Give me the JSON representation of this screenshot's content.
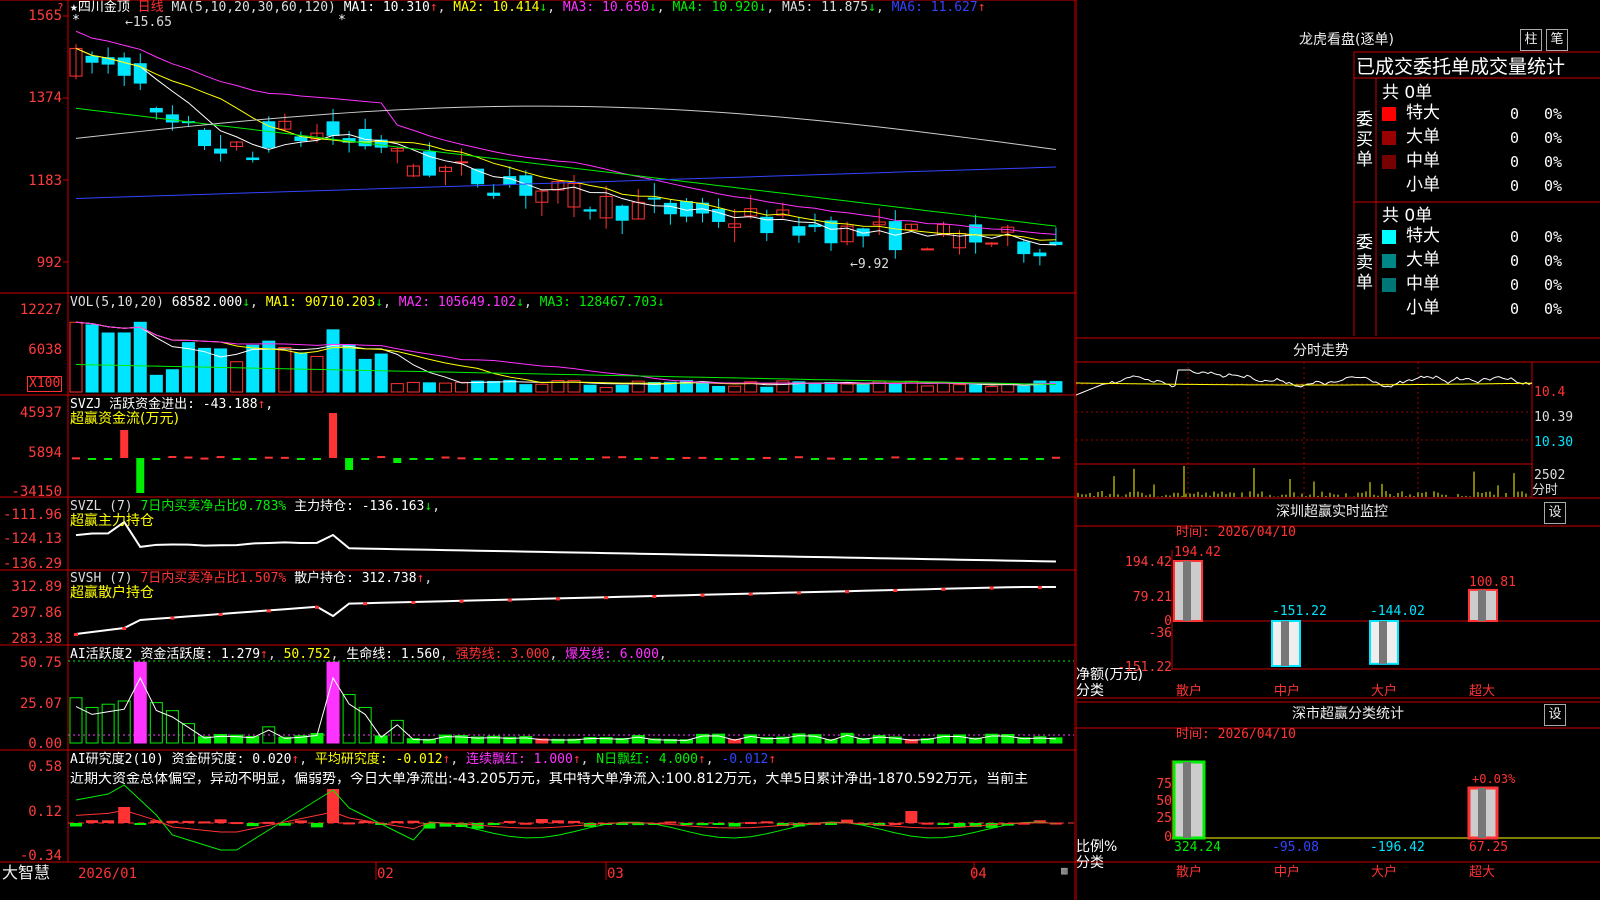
{
  "app_name": "大智慧",
  "colors": {
    "up": "#ff3333",
    "down": "#00e5ff",
    "green": "#00ee00",
    "magenta": "#ff33ff",
    "grid": "#8b0000",
    "border": "#cc0000"
  },
  "kline": {
    "stock_name": "四川金顶",
    "period": "日线",
    "ma_header": "MA(5,10,20,30,60,120)",
    "ma_items": [
      {
        "label": "MA1: 10.310",
        "arrow": "↑",
        "color": "#ffffff"
      },
      {
        "label": "MA2: 10.414",
        "arrow": "↓",
        "color": "#ffff00"
      },
      {
        "label": "MA3: 10.650",
        "arrow": "↓",
        "color": "#ff33ff"
      },
      {
        "label": "MA4: 10.920",
        "arrow": "↓",
        "color": "#00ee00"
      },
      {
        "label": "MA5: 11.875",
        "arrow": "↓",
        "color": "#dddddd"
      },
      {
        "label": "MA6: 11.627",
        "arrow": "↑",
        "color": "#3344ff"
      }
    ],
    "y_ticks": [
      "1565",
      "1374",
      "1183",
      "992"
    ],
    "high_label": "15.65",
    "low_label": "9.92",
    "x_labels": [
      "2026/01",
      "02",
      "03",
      "04"
    ]
  },
  "vol": {
    "header": "VOL(5,10,20)",
    "items": [
      {
        "label": "68582.000",
        "arrow": "↓",
        "color": "#ffffff"
      },
      {
        "label": "MA1: 90710.203",
        "arrow": "↓",
        "color": "#ffff00"
      },
      {
        "label": "MA2: 105649.102",
        "arrow": "↓",
        "color": "#ff33ff"
      },
      {
        "label": "MA3: 128467.703",
        "arrow": "↓",
        "color": "#00ee00"
      }
    ],
    "y_ticks": [
      "12227",
      "6038"
    ],
    "unit": "X100"
  },
  "svzj": {
    "header": "SVZJ  活跃资金进出: -43.188",
    "arrow": "↑",
    "subtitle": "超赢资金流(万元)",
    "y_ticks": [
      "45937",
      "5894",
      "-34150"
    ]
  },
  "svzl": {
    "header": "SVZL (7)",
    "ratio": "7日内买卖净占比0.783%",
    "holding": "主力持仓: -136.163",
    "arrow": "↓",
    "subtitle": "超赢主力持仓",
    "y_ticks": [
      "-111.96",
      "-124.13",
      "-136.29"
    ]
  },
  "svsh": {
    "header": "SVSH (7)",
    "ratio": "7日内买卖净占比1.507%",
    "holding": "散户持仓: 312.738",
    "arrow": "↑",
    "subtitle": "超赢散户持仓",
    "y_ticks": [
      "312.89",
      "297.86",
      "283.38"
    ]
  },
  "ai_active": {
    "header": "AI活跃度2",
    "value": "资金活跃度: 1.279",
    "v2": "50.752",
    "life": "生命线: 1.560",
    "strong": "强势线: 3.000",
    "burst": "爆发线: 6.000",
    "y_ticks": [
      "50.75",
      "25.07",
      "0.00"
    ]
  },
  "ai_research": {
    "header": "AI研究度2(10)",
    "value": "资金研究度: 0.020",
    "avg": "平均研究度: -0.012",
    "streak": "连续飘红: 1.000",
    "nday": "N日飘红: 4.000",
    "last": "-0.012",
    "comment": "近期大资金总体偏空，异动不明显，偏弱势，今日大单净流出:-43.205万元，其中特大单净流入:100.812万元，大单5日累计净出-1870.592万元，当前主",
    "y_ticks": [
      "0.58",
      "0.12",
      "-0.34"
    ]
  },
  "dragon": {
    "title": "龙虎看盘(逐单)",
    "btn_zhu": "柱",
    "btn_bi": "笔",
    "subtitle": "已成交委托单成交量统计",
    "buy_label": "委买单",
    "sell_label": "委卖单",
    "buy_total": "共 0单",
    "sell_total": "共 0单",
    "buy_rows": [
      {
        "name": "特大",
        "count": "0",
        "pct": "0%",
        "color": "#ff0000"
      },
      {
        "name": "大单",
        "count": "0",
        "pct": "0%",
        "color": "#990000"
      },
      {
        "name": "中单",
        "count": "0",
        "pct": "0%",
        "color": "#770000"
      },
      {
        "name": "小单",
        "count": "0",
        "pct": "0%",
        "color": "#000000"
      }
    ],
    "sell_rows": [
      {
        "name": "特大",
        "count": "0",
        "pct": "0%",
        "color": "#00ffff"
      },
      {
        "name": "大单",
        "count": "0",
        "pct": "0%",
        "color": "#008888"
      },
      {
        "name": "中单",
        "count": "0",
        "pct": "0%",
        "color": "#007777"
      },
      {
        "name": "小单",
        "count": "0",
        "pct": "0%",
        "color": "#000000"
      }
    ]
  },
  "intraday": {
    "title": "分时走势",
    "y_ticks": [
      "10.4",
      "10.39",
      "10.30"
    ],
    "vol_label": "2502",
    "vol_unit": "分时"
  },
  "monitor": {
    "title": "深圳超赢实时监控",
    "btn": "设",
    "time": "时间: 2026/04/10",
    "y_ticks": [
      "194.42",
      "79.21",
      "0",
      "-36",
      "-151.22"
    ],
    "unit_label": "净额(万元)",
    "cat_label": "分类",
    "categories": [
      "散户",
      "中户",
      "大户",
      "超大"
    ],
    "values": [
      194.42,
      -151.22,
      -144.02,
      100.81
    ],
    "value_labels": [
      "194.42",
      "-151.22",
      "-144.02",
      "100.81"
    ]
  },
  "classify": {
    "title": "深市超赢分类统计",
    "btn": "设",
    "time": "时间: 2026/04/10",
    "y_ticks": [
      "75",
      "50",
      "25",
      "0"
    ],
    "unit_label": "比例%",
    "cat_label": "分类",
    "categories": [
      "散户",
      "中户",
      "大户",
      "超大"
    ],
    "values": [
      324.24,
      -95.08,
      -196.42,
      67.25
    ],
    "value_labels": [
      "324.24",
      "-95.08",
      "-196.42",
      "67.25"
    ],
    "top_note": "+0.03%"
  },
  "chart_data": [
    {
      "type": "bar",
      "title": "深圳超赢实时监控",
      "ylabel": "净额(万元)",
      "categories": [
        "散户",
        "中户",
        "大户",
        "超大"
      ],
      "values": [
        194.42,
        -151.22,
        -144.02,
        100.81
      ],
      "ylim": [
        -151.22,
        194.42
      ]
    },
    {
      "type": "bar",
      "title": "深市超赢分类统计",
      "ylabel": "比例%",
      "categories": [
        "散户",
        "中户",
        "大户",
        "超大"
      ],
      "values": [
        324.24,
        -95.08,
        -196.42,
        67.25
      ],
      "ylim": [
        0,
        75
      ]
    }
  ]
}
